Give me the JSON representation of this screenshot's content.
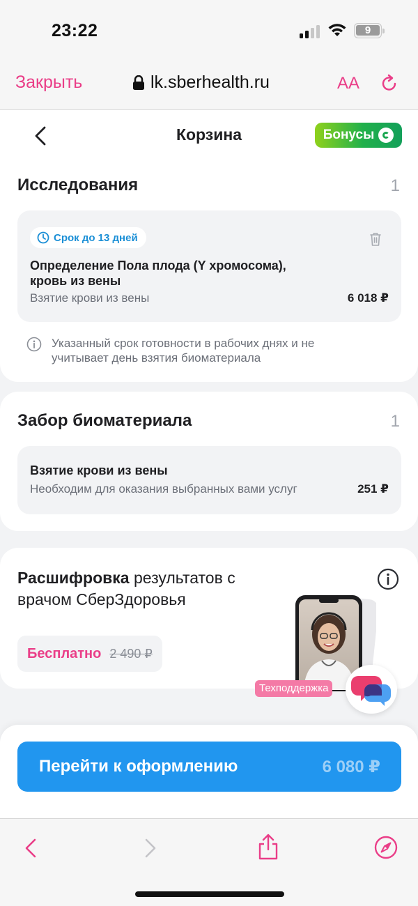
{
  "status_bar": {
    "time": "23:22",
    "battery": "9"
  },
  "browser": {
    "close_label": "Закрыть",
    "url": "lk.sberhealth.ru",
    "text_size_label": "AA",
    "accent_color": "#ea3e88"
  },
  "header": {
    "title": "Корзина",
    "bonus_label": "Бонусы"
  },
  "research": {
    "title": "Исследования",
    "count": "1",
    "item": {
      "deadline": "Срок до 13 дней",
      "name": "Определение Пола плода (Y хромосома), кровь из вены",
      "sub": "Взятие крови из вены",
      "price": "6 018 ₽"
    },
    "note": "Указанный срок готовности в рабочих днях и не учитывает день взятия биоматериала"
  },
  "biomaterial": {
    "title": "Забор биоматериала",
    "count": "1",
    "item": {
      "name": "Взятие крови из вены",
      "sub": "Необходим для оказания выбранных вами услуг",
      "price": "251 ₽"
    }
  },
  "decode": {
    "title_bold": "Расшифровка",
    "title_rest": " результатов с врачом СберЗдоровья",
    "free_label": "Бесплатно",
    "old_price": "2 490 ₽",
    "support_label": "Техподдержка"
  },
  "checkout": {
    "button_label": "Перейти к оформлению",
    "total": "6 080 ₽",
    "button_color": "#2196ef"
  }
}
